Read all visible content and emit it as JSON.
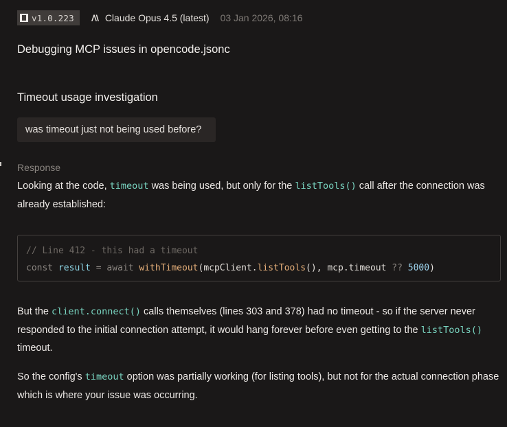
{
  "header": {
    "version": "v1.0.223",
    "model_icon": "anthropic-icon",
    "model": "Claude Opus 4.5 (latest)",
    "timestamp": "03 Jan 2026, 08:16"
  },
  "session": {
    "title": "Debugging MCP issues in opencode.jsonc"
  },
  "section": {
    "title": "Timeout usage investigation",
    "user_message": "was timeout just not being used before?"
  },
  "response": {
    "label": "Response",
    "p1": {
      "t1": "Looking at the code, ",
      "c1": "timeout",
      "t2": " was being used, but only for the ",
      "c2": "listTools()",
      "t3": " call after the connection was already established:"
    },
    "code": {
      "line1_comment": "// Line 412 - this had a timeout",
      "kw_const": "const",
      "var_result": "result",
      "op_eq": "=",
      "kw_await": "await",
      "fn_withTimeout": "withTimeout",
      "open_paren": "(",
      "obj_mcpClient": "mcpClient",
      "dot1": ".",
      "fn_listTools": "listTools",
      "args_mid": "(), mcp.timeout ",
      "op_nullish": "??",
      "num_default": "5000",
      "close_paren": ")"
    },
    "p2": {
      "t1": "But the ",
      "c1": "client.connect()",
      "t2": " calls themselves (lines 303 and 378) had no timeout - so if the server never responded to the initial connection attempt, it would hang forever before even getting to the ",
      "c2": "listTools()",
      "t3": " timeout."
    },
    "p3": {
      "t1": "So the config's ",
      "c1": "timeout",
      "t2": " option was partially working (for listing tools), but not for the actual connection phase which is where your issue was occurring."
    }
  }
}
